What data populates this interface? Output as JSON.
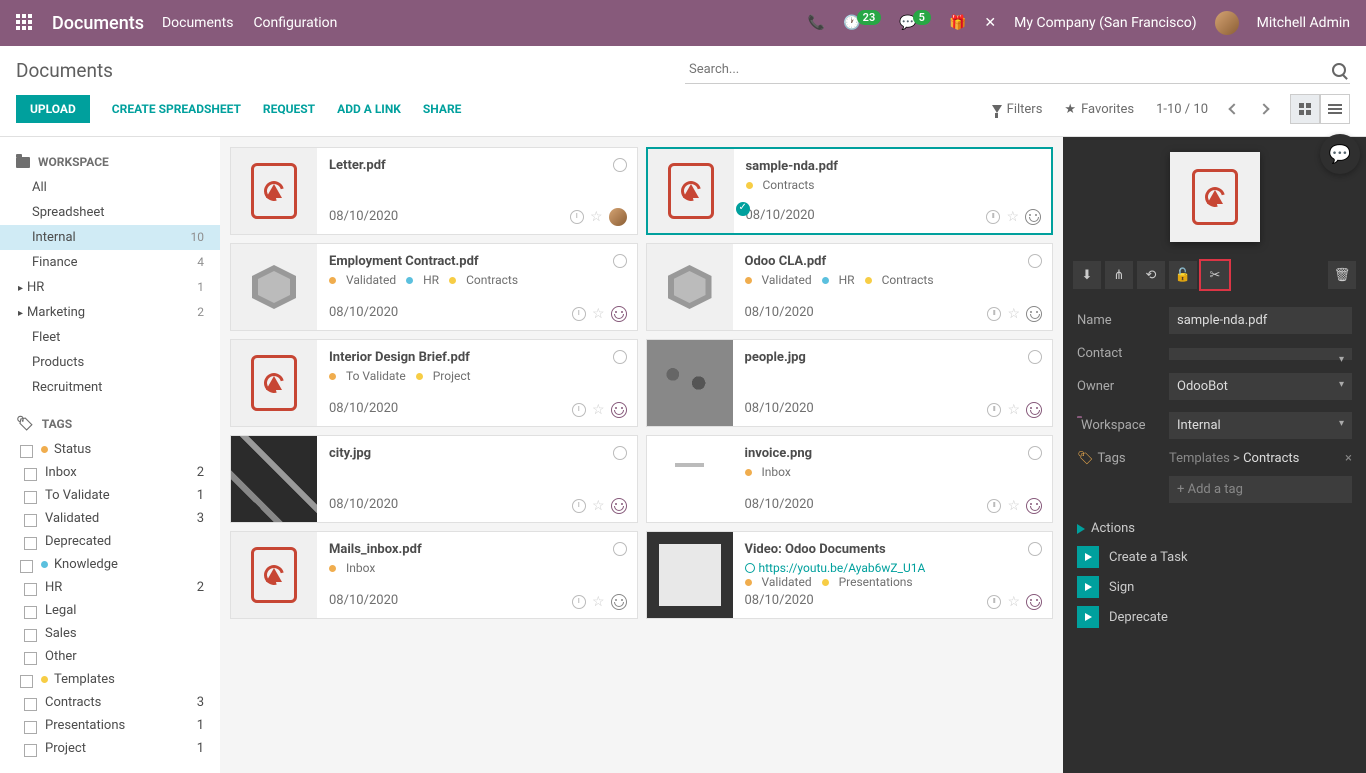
{
  "topnav": {
    "brand": "Documents",
    "links": [
      "Documents",
      "Configuration"
    ],
    "badge_activities": "23",
    "badge_discuss": "5",
    "company": "My Company (San Francisco)",
    "user": "Mitchell Admin"
  },
  "title": "Documents",
  "search_placeholder": "Search...",
  "actions": {
    "upload": "UPLOAD",
    "create_spreadsheet": "CREATE SPREADSHEET",
    "request": "REQUEST",
    "add_link": "ADD A LINK",
    "share": "SHARE",
    "filters": "Filters",
    "favorites": "Favorites",
    "pager": "1-10 / 10"
  },
  "sidebar": {
    "workspace_header": "WORKSPACE",
    "tags_header": "TAGS",
    "workspaces": [
      {
        "label": "All",
        "count": ""
      },
      {
        "label": "Spreadsheet",
        "count": ""
      },
      {
        "label": "Internal",
        "count": "10",
        "active": true
      },
      {
        "label": "Finance",
        "count": "4"
      },
      {
        "label": "HR",
        "count": "1",
        "caret": true
      },
      {
        "label": "Marketing",
        "count": "2",
        "caret": true
      },
      {
        "label": "Fleet",
        "count": ""
      },
      {
        "label": "Products",
        "count": ""
      },
      {
        "label": "Recruitment",
        "count": ""
      }
    ],
    "tag_groups": [
      {
        "label": "Status",
        "color": "dot-orange",
        "items": [
          {
            "label": "Inbox",
            "count": "2"
          },
          {
            "label": "To Validate",
            "count": "1"
          },
          {
            "label": "Validated",
            "count": "3"
          },
          {
            "label": "Deprecated",
            "count": ""
          }
        ]
      },
      {
        "label": "Knowledge",
        "color": "dot-blue",
        "items": [
          {
            "label": "HR",
            "count": "2"
          },
          {
            "label": "Legal",
            "count": ""
          },
          {
            "label": "Sales",
            "count": ""
          },
          {
            "label": "Other",
            "count": ""
          }
        ]
      },
      {
        "label": "Templates",
        "color": "dot-yellow",
        "items": [
          {
            "label": "Contracts",
            "count": "3"
          },
          {
            "label": "Presentations",
            "count": "1"
          },
          {
            "label": "Project",
            "count": "1"
          }
        ]
      }
    ]
  },
  "cards": [
    {
      "title": "Letter.pdf",
      "thumb": "pdf",
      "tags": [],
      "date": "08/10/2020",
      "avatar": true
    },
    {
      "title": "sample-nda.pdf",
      "thumb": "pdf",
      "tags": [
        {
          "dot": "dot-yellow",
          "text": "Contracts"
        }
      ],
      "date": "08/10/2020",
      "selected": true,
      "face": "plain"
    },
    {
      "title": "Employment Contract.pdf",
      "thumb": "box",
      "tags": [
        {
          "dot": "dot-orange",
          "text": "Validated"
        },
        {
          "dot": "dot-blue",
          "text": "HR"
        },
        {
          "dot": "dot-yellow",
          "text": "Contracts"
        }
      ],
      "date": "08/10/2020",
      "face": "purple"
    },
    {
      "title": "Odoo CLA.pdf",
      "thumb": "box",
      "tags": [
        {
          "dot": "dot-orange",
          "text": "Validated"
        },
        {
          "dot": "dot-blue",
          "text": "HR"
        },
        {
          "dot": "dot-yellow",
          "text": "Contracts"
        }
      ],
      "date": "08/10/2020",
      "face": "plain"
    },
    {
      "title": "Interior Design Brief.pdf",
      "thumb": "pdf",
      "tags": [
        {
          "dot": "dot-orange",
          "text": "To Validate"
        },
        {
          "dot": "dot-yellow",
          "text": "Project"
        }
      ],
      "date": "08/10/2020",
      "face": "purple"
    },
    {
      "title": "people.jpg",
      "thumb": "img-people",
      "tags": [],
      "date": "08/10/2020",
      "face": "purple"
    },
    {
      "title": "city.jpg",
      "thumb": "img-city",
      "tags": [],
      "date": "08/10/2020",
      "face": "purple"
    },
    {
      "title": "invoice.png",
      "thumb": "img-invoice",
      "tags": [
        {
          "dot": "dot-orange",
          "text": "Inbox"
        }
      ],
      "date": "08/10/2020",
      "face": "purple"
    },
    {
      "title": "Mails_inbox.pdf",
      "thumb": "pdf",
      "tags": [
        {
          "dot": "dot-orange",
          "text": "Inbox"
        }
      ],
      "date": "08/10/2020",
      "face": "plain"
    },
    {
      "title": "Video: Odoo Documents",
      "thumb": "img-video",
      "url": "https://youtu.be/Ayab6wZ_U1A",
      "tags": [
        {
          "dot": "dot-orange",
          "text": "Validated"
        },
        {
          "dot": "dot-yellow",
          "text": "Presentations"
        }
      ],
      "date": "08/10/2020",
      "face": "purple"
    }
  ],
  "detail": {
    "fields": {
      "name_label": "Name",
      "name_value": "sample-nda.pdf",
      "contact_label": "Contact",
      "contact_value": "",
      "owner_label": "Owner",
      "owner_value": "OdooBot",
      "workspace_label": "Workspace",
      "workspace_value": "Internal",
      "tags_label": "Tags",
      "tags_category": "Templates",
      "tags_sep": " > ",
      "tags_value": "Contracts",
      "add_tag": "+ Add a tag"
    },
    "actions_header": "Actions",
    "actions": [
      "Create a Task",
      "Sign",
      "Deprecate"
    ]
  }
}
